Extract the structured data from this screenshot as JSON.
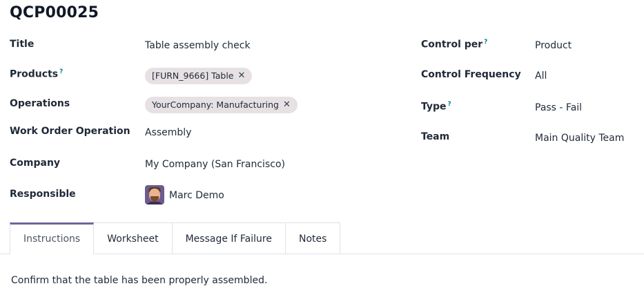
{
  "record": {
    "name": "QCP00025"
  },
  "left_fields": {
    "title": {
      "label": "Title",
      "value": "Table assembly check"
    },
    "products": {
      "label": "Products",
      "help": "?",
      "tags": [
        "[FURN_9666] Table"
      ]
    },
    "operations": {
      "label": "Operations",
      "tags": [
        "YourCompany: Manufacturing"
      ]
    },
    "work_order_operation": {
      "label": "Work Order Operation",
      "value": "Assembly"
    },
    "company": {
      "label": "Company",
      "value": "My Company (San Francisco)"
    },
    "responsible": {
      "label": "Responsible",
      "value": "Marc Demo"
    }
  },
  "right_fields": {
    "control_per": {
      "label": "Control per",
      "help": "?",
      "value": "Product"
    },
    "control_frequency": {
      "label": "Control Frequency",
      "value": "All"
    },
    "type": {
      "label": "Type",
      "help": "?",
      "value": "Pass - Fail"
    },
    "team": {
      "label": "Team",
      "value": "Main Quality Team"
    }
  },
  "tag_remove_glyph": "✕",
  "tabs": [
    {
      "label": "Instructions",
      "active": true
    },
    {
      "label": "Worksheet",
      "active": false
    },
    {
      "label": "Message If Failure",
      "active": false
    },
    {
      "label": "Notes",
      "active": false
    }
  ],
  "tab_content": {
    "instructions_text": "Confirm that the table has been properly assembled."
  },
  "colors": {
    "accent": "#71639e",
    "tag_bg": "#e7e1e3",
    "help": "#017e84",
    "border": "#dee2e6"
  },
  "icons": {
    "avatar": "user-avatar-icon",
    "remove": "close-icon"
  }
}
